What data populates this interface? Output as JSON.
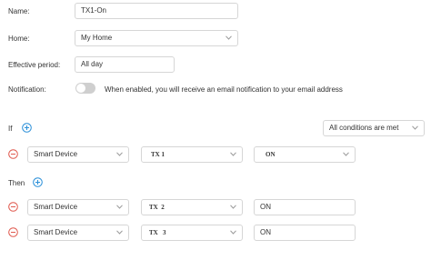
{
  "form": {
    "name_label": "Name:",
    "name_value": "TX1-On",
    "home_label": "Home:",
    "home_value": "My Home",
    "period_label": "Effective period:",
    "period_value": "All day",
    "notification_label": "Notification:",
    "notification_text": "When enabled, you will receive an email notification to your email address",
    "notification_enabled": false
  },
  "conditions": {
    "if_label": "If",
    "match_mode": "All conditions are met",
    "rows": [
      {
        "type": "Smart Device",
        "device": "TX 1",
        "state": "ON"
      }
    ]
  },
  "actions": {
    "then_label": "Then",
    "rows": [
      {
        "type": "Smart Device",
        "device": "TX  2",
        "state": "ON"
      },
      {
        "type": "Smart Device",
        "device": "TX   3",
        "state": "ON"
      }
    ]
  },
  "colors": {
    "accent": "#2a8fd8",
    "remove": "#e05a4f",
    "toggle_off": "#cfcfcf"
  },
  "icons": {
    "add": "plus-circle-icon",
    "remove": "minus-circle-icon",
    "dropdown": "chevron-down-icon"
  }
}
